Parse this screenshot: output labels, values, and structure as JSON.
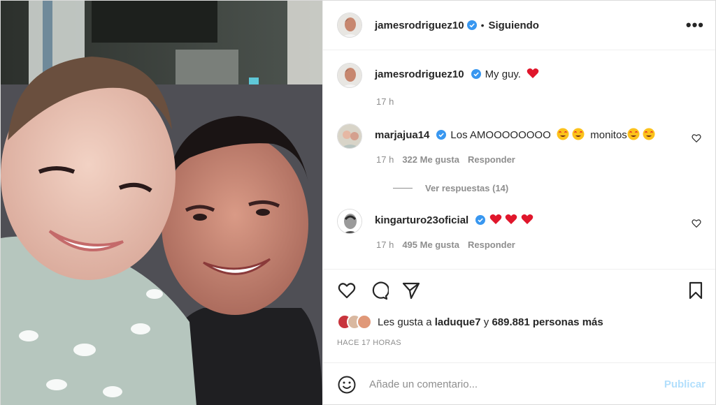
{
  "header": {
    "username": "jamesrodriguez10",
    "separator": "•",
    "follow_status": "Siguiendo",
    "more_label": "•••"
  },
  "caption": {
    "username": "jamesrodriguez10",
    "text": "My guy.",
    "time": "17 h"
  },
  "comments": [
    {
      "username": "marjajua14",
      "text_a": "Los AMOOOOOOOO",
      "text_b": "monitos",
      "time": "17 h",
      "likes": "322 Me gusta",
      "reply": "Responder"
    },
    {
      "username": "kingarturo23oficial",
      "time": "17 h",
      "likes": "495 Me gusta",
      "reply": "Responder"
    }
  ],
  "view_replies": "Ver respuestas (14)",
  "likes_line": {
    "prefix": "Les gusta a",
    "user": "laduque7",
    "middle": "y",
    "count": "689.881 personas más"
  },
  "timestamp": "HACE 17 HORAS",
  "add_comment": {
    "placeholder": "Añade un comentario...",
    "publish": "Publicar"
  },
  "colors": {
    "verified": "#3897f0",
    "heart_red": "#ed4956",
    "publish_disabled": "#b2dffc",
    "muted": "#8e8e8e"
  },
  "icons": [
    "verified-badge-icon",
    "more-options-icon",
    "heart-icon",
    "comment-icon",
    "share-icon",
    "bookmark-icon",
    "emoji-icon",
    "like-comment-icon",
    "red-heart-emoji",
    "heart-eyes-emoji"
  ]
}
